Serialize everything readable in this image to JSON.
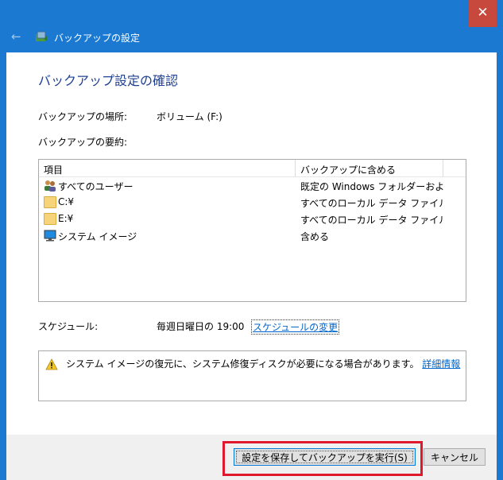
{
  "window": {
    "title": "バックアップの設定",
    "close_glyph": "✕",
    "back_glyph": "←"
  },
  "page": {
    "heading": "バックアップ設定の確認",
    "location_label": "バックアップの場所:",
    "location_value": "ボリューム (F:)",
    "summary_label": "バックアップの要約:"
  },
  "table": {
    "columns": [
      "項目",
      "バックアップに含める"
    ],
    "rows": [
      {
        "icon": "users-icon",
        "item": "すべてのユーザー",
        "include": "既定の Windows フォルダーおよ..."
      },
      {
        "icon": "folder-icon",
        "item": "C:¥",
        "include": "すべてのローカル データ ファイル"
      },
      {
        "icon": "folder-icon",
        "item": "E:¥",
        "include": "すべてのローカル データ ファイル"
      },
      {
        "icon": "monitor-icon",
        "item": "システム イメージ",
        "include": "含める"
      }
    ]
  },
  "schedule": {
    "label": "スケジュール:",
    "value": "毎週日曜日の 19:00",
    "change_link": "スケジュールの変更"
  },
  "warning": {
    "text": "システム イメージの復元に、システム修復ディスクが必要になる場合があります。",
    "link": "詳細情報"
  },
  "buttons": {
    "save_run": "設定を保存してバックアップを実行(S)",
    "cancel": "キャンセル"
  },
  "colors": {
    "titlebar": "#1b79d1",
    "heading": "#1e3f92",
    "close": "#c7483d",
    "highlight": "#e0182d"
  }
}
